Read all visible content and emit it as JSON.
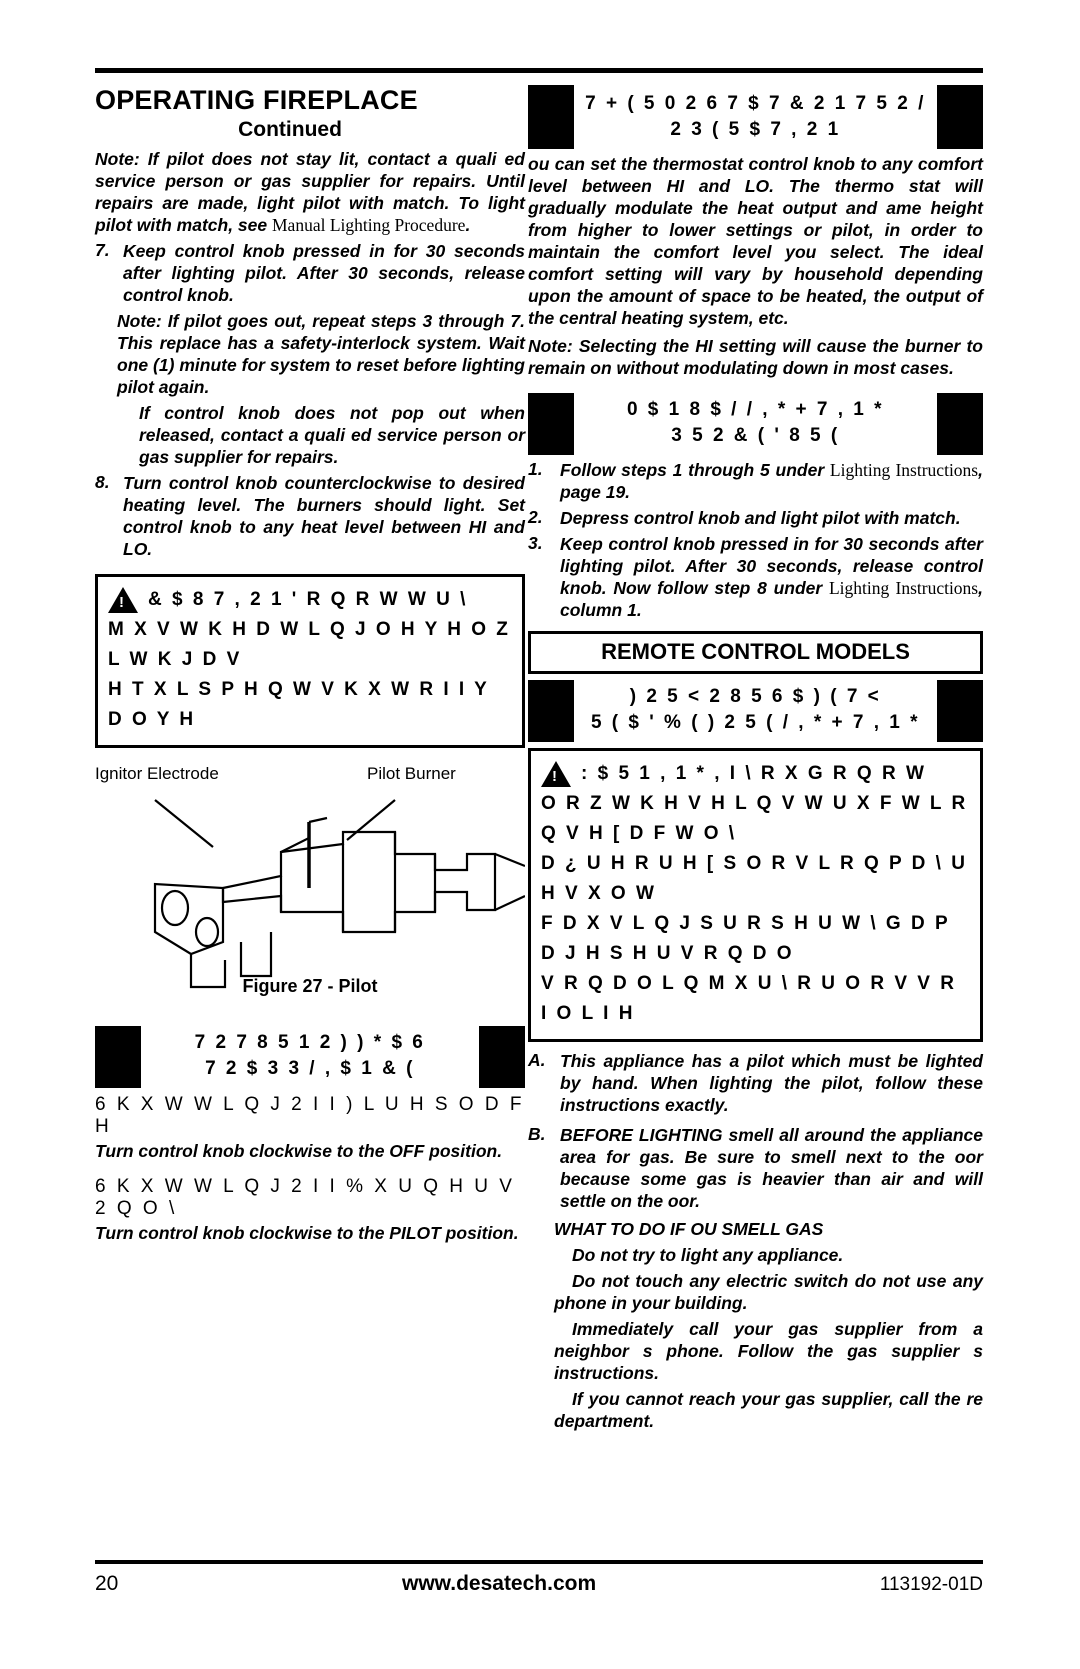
{
  "page": {
    "number": "20",
    "website": "www.desatech.com",
    "doc_code": "113192-01D"
  },
  "left": {
    "title": "OPERATING FIREPLACE",
    "subtitle": "Continued",
    "note1": "Note: If pilot does not stay lit, contact a quali ed service person or gas supplier for repairs. Until repairs are made, light pilot with match. To light pilot with match, see",
    "note1_ref": "Manual Lighting Procedure",
    "note1_end": ".",
    "step7_num": "7.",
    "step7_text": "Keep control knob pressed in for 30 seconds after lighting pilot. After 30 seconds, release control knob.",
    "note2": "Note: If pilot goes out, repeat steps 3 through 7. This  replace has a safety-interlock system. Wait one (1) minute for system to reset before lighting pilot again.",
    "note2b": "If control knob does not pop out when released, contact a quali ed service person or gas supplier for repairs.",
    "step8_num": "8.",
    "step8_text": "Turn control knob counterclockwise        to desired heating level. The burners should light. Set control knob to any heat level between HI and LO.",
    "caution_line1": "& $ 8 7 , 2 1   ' R   Q R W   W U \\",
    "caution_line2": "M X V W   K H D W L Q J   O H Y H O   Z L W K   J D V",
    "caution_line3": "H T X L S P H Q W   V K X W R I I   Y D O Y H",
    "figure": {
      "label_left": "Ignitor Electrode",
      "label_right": "Pilot Burner",
      "caption": "Figure 27 - Pilot"
    },
    "shutoff_heading_line1": "7 2   7 8 5 1   2 ) )   * $ 6",
    "shutoff_heading_line2": "7 2   $ 3 3 / , $ 1 & (",
    "shutoff_sub1": "6 K X W W L Q J   2 I I   ) L U H S O D F H",
    "shutoff_text1": "Turn control knob clockwise        to the OFF position.",
    "shutoff_sub2": "6 K X W W L Q J   2 I I   % X U Q H U V   2 Q O \\",
    "shutoff_text2": "Turn control knob clockwise        to the PILOT position."
  },
  "right": {
    "thermostat_heading_line1": "7 + ( 5 0 2 6 7 $ 7   & 2 1 7 5 2 /",
    "thermostat_heading_line2": "2 3 ( 5 $ 7 , 2 1",
    "thermostat_body": "ou can set the thermostat control knob to any comfort level between HI and LO. The thermo stat will gradually modulate the heat output and  ame height from higher to lower settings or pilot, in order to maintain the comfort level you select. The ideal comfort setting will vary by household depending upon the amount of space to be heated, the output of the central heating system, etc.",
    "thermostat_note": "Note: Selecting the HI setting will cause the burner to remain on without modulating down in most cases.",
    "manual_heading_line1": "0 $ 1 8 $ /   / , * + 7 , 1 *",
    "manual_heading_line2": "3 5 2 & ( ' 8 5 (",
    "manual_step1_num": "1.",
    "manual_step1_a": "Follow steps 1 through 5 under",
    "manual_step1_ref": "Lighting Instructions",
    "manual_step1_b": ", page 19.",
    "manual_step2_num": "2.",
    "manual_step2": "Depress control knob and light pilot with match.",
    "manual_step3_num": "3.",
    "manual_step3_a": "Keep control knob pressed in for 30 seconds after lighting pilot. After 30 seconds, release control knob. Now follow step 8 under",
    "manual_step3_ref": "Lighting Instructions",
    "manual_step3_b": ", column 1.",
    "remote_box_title": "REMOTE CONTROL MODELS",
    "remote_heading_line1": ") 2 5   < 2 8 5   6 $ ) ( 7 <",
    "remote_heading_line2": "5 ( $ '   % ( ) 2 5 (   / , * + 7 , 1 *",
    "warning_line1": ": $ 5 1 , 1 *   , I   \\ R X   G R   Q R W",
    "warning_line2": "O R Z   W K H V H   L Q V W U X F W L R Q V   H [ D F W O \\",
    "warning_line3": "D  ¿ U H   R U   H [ S O R V L R Q   P D \\   U H V X O W",
    "warning_line4": "F D X V L Q J   S U R S H U W \\   G D P D J H   S H U V R Q D O",
    "warning_line5": "V R Q D O   L Q M X U \\   R U   O R V V   R I   O L I H",
    "item_a_letter": "A.",
    "item_a": "This appliance has a pilot which must be lighted by hand. When lighting the pilot, follow these instructions exactly.",
    "item_b_letter": "B.",
    "item_b_1": "BEFORE LIGHTING",
    "item_b_2": "smell all around the appliance area for gas. Be sure to smell next to the  oor because some gas is heavier than air and will settle on the   oor.",
    "item_b_overlap": "the  oor because some gas",
    "what_to_do": "WHAT TO DO IF  OU SMELL GAS",
    "bullets": [
      "Do not try to light any appliance.",
      "Do not touch any electric switch    do not use any phone in your building.",
      "Immediately call your gas supplier from a neighbor  s phone. Follow the gas supplier  s instructions.",
      "If you cannot reach your gas supplier, call the   re department."
    ]
  }
}
